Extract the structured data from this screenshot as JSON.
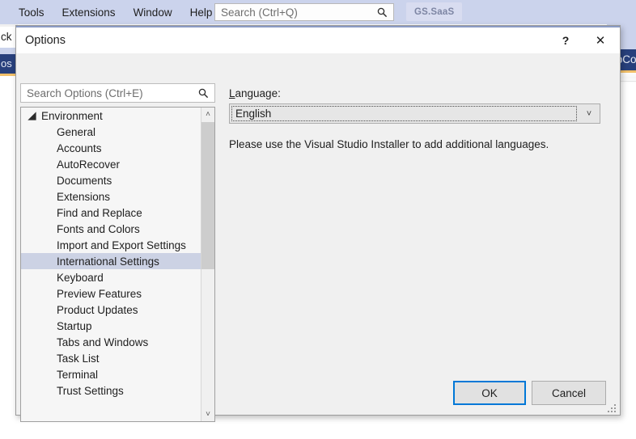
{
  "ide": {
    "menu_items": [
      "Tools",
      "Extensions",
      "Window",
      "Help"
    ],
    "search": {
      "placeholder": "Search (Ctrl+Q)",
      "icon": "search-icon"
    },
    "solution_tab": "GS.SaaS",
    "background_text": {
      "left_top": "ck",
      "left_bottom": "os",
      "right_tab": "DbCo"
    },
    "colors": {
      "menu_bar": "#cbd3ec",
      "tab_active": "#28407c",
      "tab_underline": "#f2c06a"
    }
  },
  "dialog": {
    "title": "Options",
    "help_glyph": "?",
    "close_glyph": "✕",
    "search": {
      "placeholder": "Search Options (Ctrl+E)",
      "value": "",
      "icon": "search-icon"
    },
    "tree": {
      "root": {
        "label": "Environment",
        "expander_glyph": "◢",
        "expanded": true
      },
      "items": [
        {
          "label": "General",
          "selected": false
        },
        {
          "label": "Accounts",
          "selected": false
        },
        {
          "label": "AutoRecover",
          "selected": false
        },
        {
          "label": "Documents",
          "selected": false
        },
        {
          "label": "Extensions",
          "selected": false
        },
        {
          "label": "Find and Replace",
          "selected": false
        },
        {
          "label": "Fonts and Colors",
          "selected": false
        },
        {
          "label": "Import and Export Settings",
          "selected": false
        },
        {
          "label": "International Settings",
          "selected": true
        },
        {
          "label": "Keyboard",
          "selected": false
        },
        {
          "label": "Preview Features",
          "selected": false
        },
        {
          "label": "Product Updates",
          "selected": false
        },
        {
          "label": "Startup",
          "selected": false
        },
        {
          "label": "Tabs and Windows",
          "selected": false
        },
        {
          "label": "Task List",
          "selected": false
        },
        {
          "label": "Terminal",
          "selected": false
        },
        {
          "label": "Trust Settings",
          "selected": false
        }
      ],
      "scrollbar": {
        "up_glyph": "˄",
        "down_glyph": "˅"
      },
      "selection_color": "#ccd2e4"
    },
    "pane": {
      "language_label_accel": "L",
      "language_label_rest": "anguage:",
      "language_value": "English",
      "combo_arrow_glyph": "˅",
      "hint": "Please use the Visual Studio Installer to add additional languages."
    },
    "buttons": {
      "ok": "OK",
      "cancel": "Cancel",
      "default_focus_color": "#0078d7"
    }
  }
}
